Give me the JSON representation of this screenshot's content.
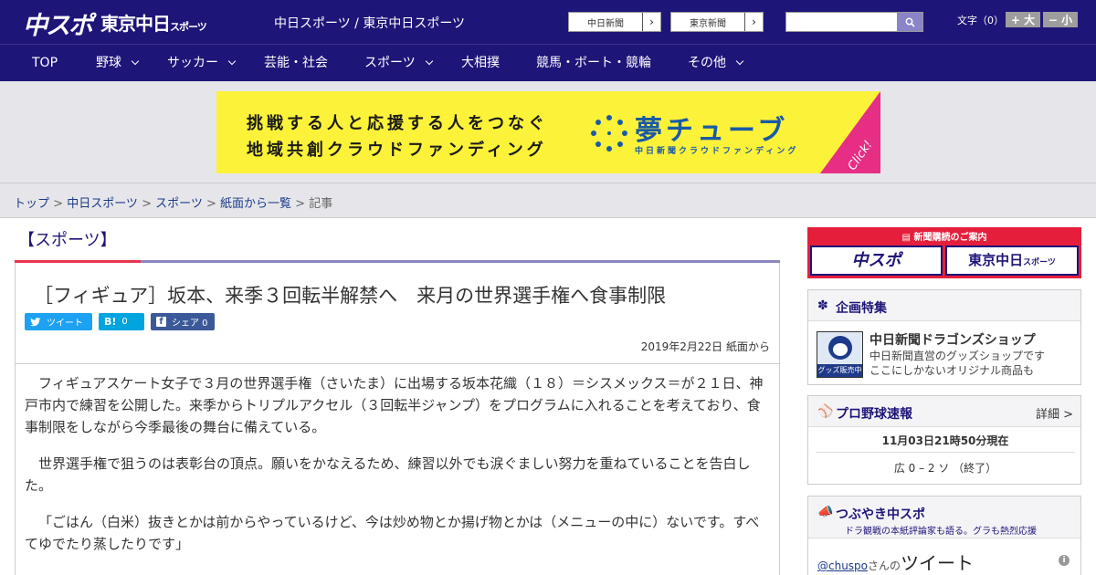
{
  "header": {
    "logo_main": "中スポ",
    "logo_tokyo": "東京中日",
    "logo_tokyo_suffix": "スポーツ",
    "site_name": "中日スポーツ / 東京中日スポーツ",
    "btn_chunichi": "中日新聞",
    "btn_tokyo": "東京新聞",
    "search_placeholder": "",
    "font_label": "文字（0）",
    "font_larger": "+ 大",
    "font_smaller": "− 小"
  },
  "nav": {
    "items": [
      {
        "label": "TOP"
      },
      {
        "label": "野球"
      },
      {
        "label": "サッカー"
      },
      {
        "label": "芸能・社会"
      },
      {
        "label": "スポーツ"
      },
      {
        "label": "大相撲"
      },
      {
        "label": "競馬・ボート・競輪"
      },
      {
        "label": "その他"
      }
    ]
  },
  "banner": {
    "line1": "挑戦する人と応援する人をつなぐ",
    "line2": "地域共創クラウドファンディング",
    "brand": "夢チューブ",
    "brand_sub": "中日新聞クラウドファンディング",
    "click": "Click!"
  },
  "breadcrumb": {
    "top": "トップ",
    "chunichi": "中日スポーツ",
    "sports": "スポーツ",
    "paper": "紙面から一覧",
    "current": "記事",
    "sep": " > "
  },
  "article": {
    "category": "【スポーツ】",
    "title": "［フィギュア］坂本、来季３回転半解禁へ　来月の世界選手権へ食事制限",
    "share_tweet": "ツイート",
    "share_hatena": "0",
    "share_fb": "シェア 0",
    "date": "2019年2月22日 紙面から",
    "paragraphs": [
      "フィギュアスケート女子で３月の世界選手権（さいたま）に出場する坂本花織（１８）＝シスメックス＝が２１日、神戸市内で練習を公開した。来季からトリプルアクセル（３回転半ジャンプ）をプログラムに入れることを考えており、食事制限をしながら今季最後の舞台に備えている。",
      "世界選手権で狙うのは表彰台の頂点。願いをかなえるため、練習以外でも涙ぐましい努力を重ねていることを告白した。",
      "「ごはん（白米）抜きとかは前からやっているけど、今は炒め物とか揚げ物とかは（メニューの中に）ないです。すべてゆでたり蒸したりです」"
    ]
  },
  "sidebar": {
    "subscribe_header": "新聞購読のご案内",
    "subscribe_chuspo": "中スポ",
    "subscribe_tokyo": "東京中日",
    "subscribe_tokyo_suffix": "スポーツ",
    "feature_title": "企画特集",
    "shop_title": "中日新聞ドラゴンズショップ",
    "shop_desc1": "中日新聞直営のグッズショップです",
    "shop_desc2": "ここにしかないオリジナル商品も",
    "shop_img_label": "グッズ販売中",
    "baseball_title": "プロ野球速報",
    "baseball_more": "詳細 >",
    "baseball_time": "11月03日21時50分現在",
    "baseball_score": "広 0 – 2 ソ （終了）",
    "tweet_title": "つぶやき中スポ",
    "tweet_sub": "ドラ観戦の本紙評論家も語る。グラも熱烈応援",
    "tweet_user": "@chuspo",
    "tweet_user_suffix": "さんの",
    "tweet_word": "ツイート"
  },
  "colors": {
    "header_bg": "#1e1578",
    "accent_red": "#e8354e",
    "banner_yellow": "#fcf23a",
    "banner_blue": "#1a5aa6",
    "click_pink": "#e62e85"
  }
}
